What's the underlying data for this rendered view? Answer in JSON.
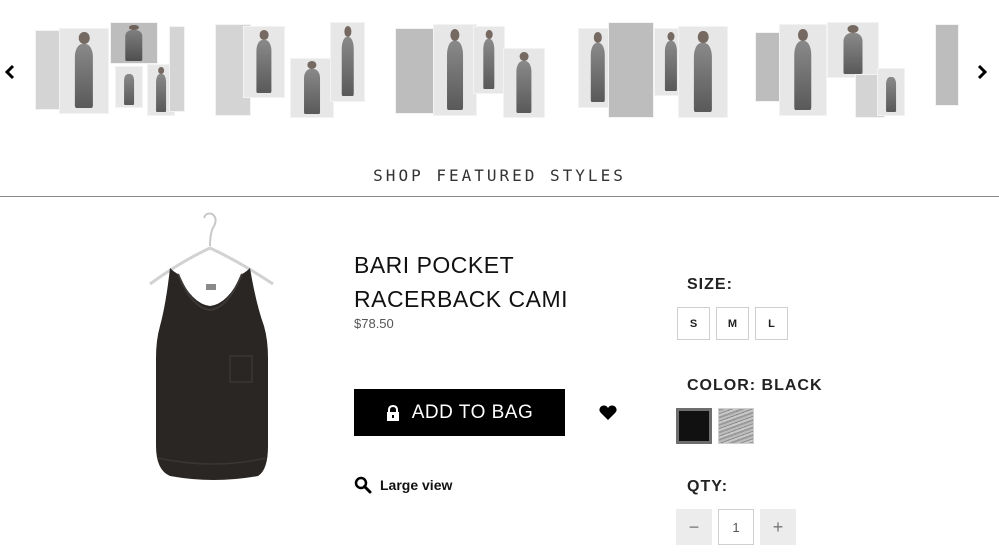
{
  "carousel": {
    "prev_icon": "chevron-left-icon",
    "next_icon": "chevron-right-icon",
    "thumbnails": [
      {
        "name": "lookbook-thumb-1"
      },
      {
        "name": "lookbook-thumb-2"
      },
      {
        "name": "lookbook-thumb-3"
      },
      {
        "name": "lookbook-thumb-4"
      },
      {
        "name": "lookbook-thumb-5"
      },
      {
        "name": "lookbook-thumb-6"
      }
    ]
  },
  "section": {
    "title": "SHOP FEATURED STYLES"
  },
  "product": {
    "name_line1": "BARI POCKET",
    "name_line2": "RACERBACK CAMI",
    "price": "$78.50",
    "add_to_bag_label": "ADD TO BAG",
    "large_view_label": "Large view"
  },
  "options": {
    "size_label": "SIZE:",
    "sizes": [
      "S",
      "M",
      "L"
    ],
    "color_label": "COLOR: BLACK",
    "colors": [
      {
        "name": "black",
        "hex": "#111111"
      },
      {
        "name": "heather-grey",
        "hex": "#a8a8a8"
      }
    ],
    "qty_label": "QTY:",
    "qty_value": "1",
    "qty_minus": "−",
    "qty_plus": "+"
  }
}
